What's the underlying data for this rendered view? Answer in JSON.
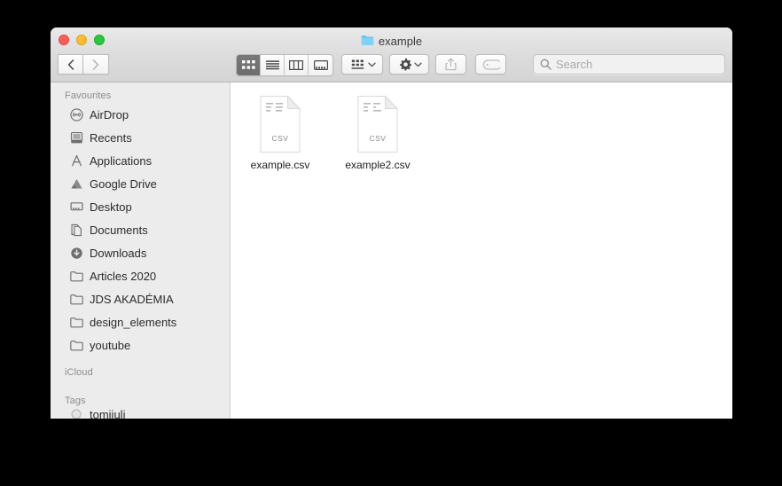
{
  "window": {
    "title": "example",
    "title_icon": "folder-icon",
    "controls": {
      "close": "close-button",
      "minimize": "minimize-button",
      "maximize": "maximize-button"
    },
    "colors": {
      "close": "#ff5f57",
      "minimize": "#febc2e",
      "maximize": "#28c840",
      "folder": "#6ecbf5",
      "sidebar_bg": "#ececec",
      "titlebar_bg": "#dcdcdc",
      "content_bg": "#ffffff",
      "desktop_bg": "#000000",
      "selected_segment": "#737373"
    }
  },
  "toolbar": {
    "nav": [
      {
        "name": "back-button",
        "icon": "chevron-left-icon",
        "enabled": true
      },
      {
        "name": "forward-button",
        "icon": "chevron-right-icon",
        "enabled": false
      }
    ],
    "view_modes": [
      {
        "name": "icon-view-button",
        "icon": "grid-icon",
        "selected": true
      },
      {
        "name": "list-view-button",
        "icon": "list-icon",
        "selected": false
      },
      {
        "name": "column-view-button",
        "icon": "columns-icon",
        "selected": false
      },
      {
        "name": "gallery-view-button",
        "icon": "gallery-icon",
        "selected": false
      }
    ],
    "arrange": {
      "name": "arrange-button",
      "icon": "group-icon",
      "chevron": "chevron-down-icon"
    },
    "action": {
      "name": "action-button",
      "icon": "gear-icon",
      "chevron": "chevron-down-icon"
    },
    "share": {
      "name": "share-button",
      "icon": "share-icon",
      "enabled": false
    },
    "tags": {
      "name": "tags-button",
      "icon": "tag-icon",
      "enabled": false
    }
  },
  "search": {
    "icon": "search-icon",
    "placeholder": "Search",
    "value": ""
  },
  "sidebar": {
    "sections": [
      {
        "label": "Favourites",
        "items": [
          {
            "label": "AirDrop",
            "icon": "airdrop-icon"
          },
          {
            "label": "Recents",
            "icon": "recents-icon"
          },
          {
            "label": "Applications",
            "icon": "applications-icon"
          },
          {
            "label": "Google Drive",
            "icon": "google-drive-icon"
          },
          {
            "label": "Desktop",
            "icon": "desktop-icon"
          },
          {
            "label": "Documents",
            "icon": "documents-icon"
          },
          {
            "label": "Downloads",
            "icon": "downloads-icon"
          },
          {
            "label": "Articles 2020",
            "icon": "folder-icon"
          },
          {
            "label": "JDS AKADÉMIA",
            "icon": "folder-icon"
          },
          {
            "label": "design_elements",
            "icon": "folder-icon"
          },
          {
            "label": "youtube",
            "icon": "folder-icon"
          }
        ]
      },
      {
        "label": "iCloud",
        "items": []
      },
      {
        "label": "Tags",
        "items": [
          {
            "label": "tomijuli",
            "icon": "tag-circle-icon"
          }
        ]
      }
    ]
  },
  "content": {
    "files": [
      {
        "name": "example.csv",
        "icon": "csv-file-icon",
        "badge": "CSV"
      },
      {
        "name": "example2.csv",
        "icon": "csv-file-icon",
        "badge": "CSV"
      }
    ]
  }
}
